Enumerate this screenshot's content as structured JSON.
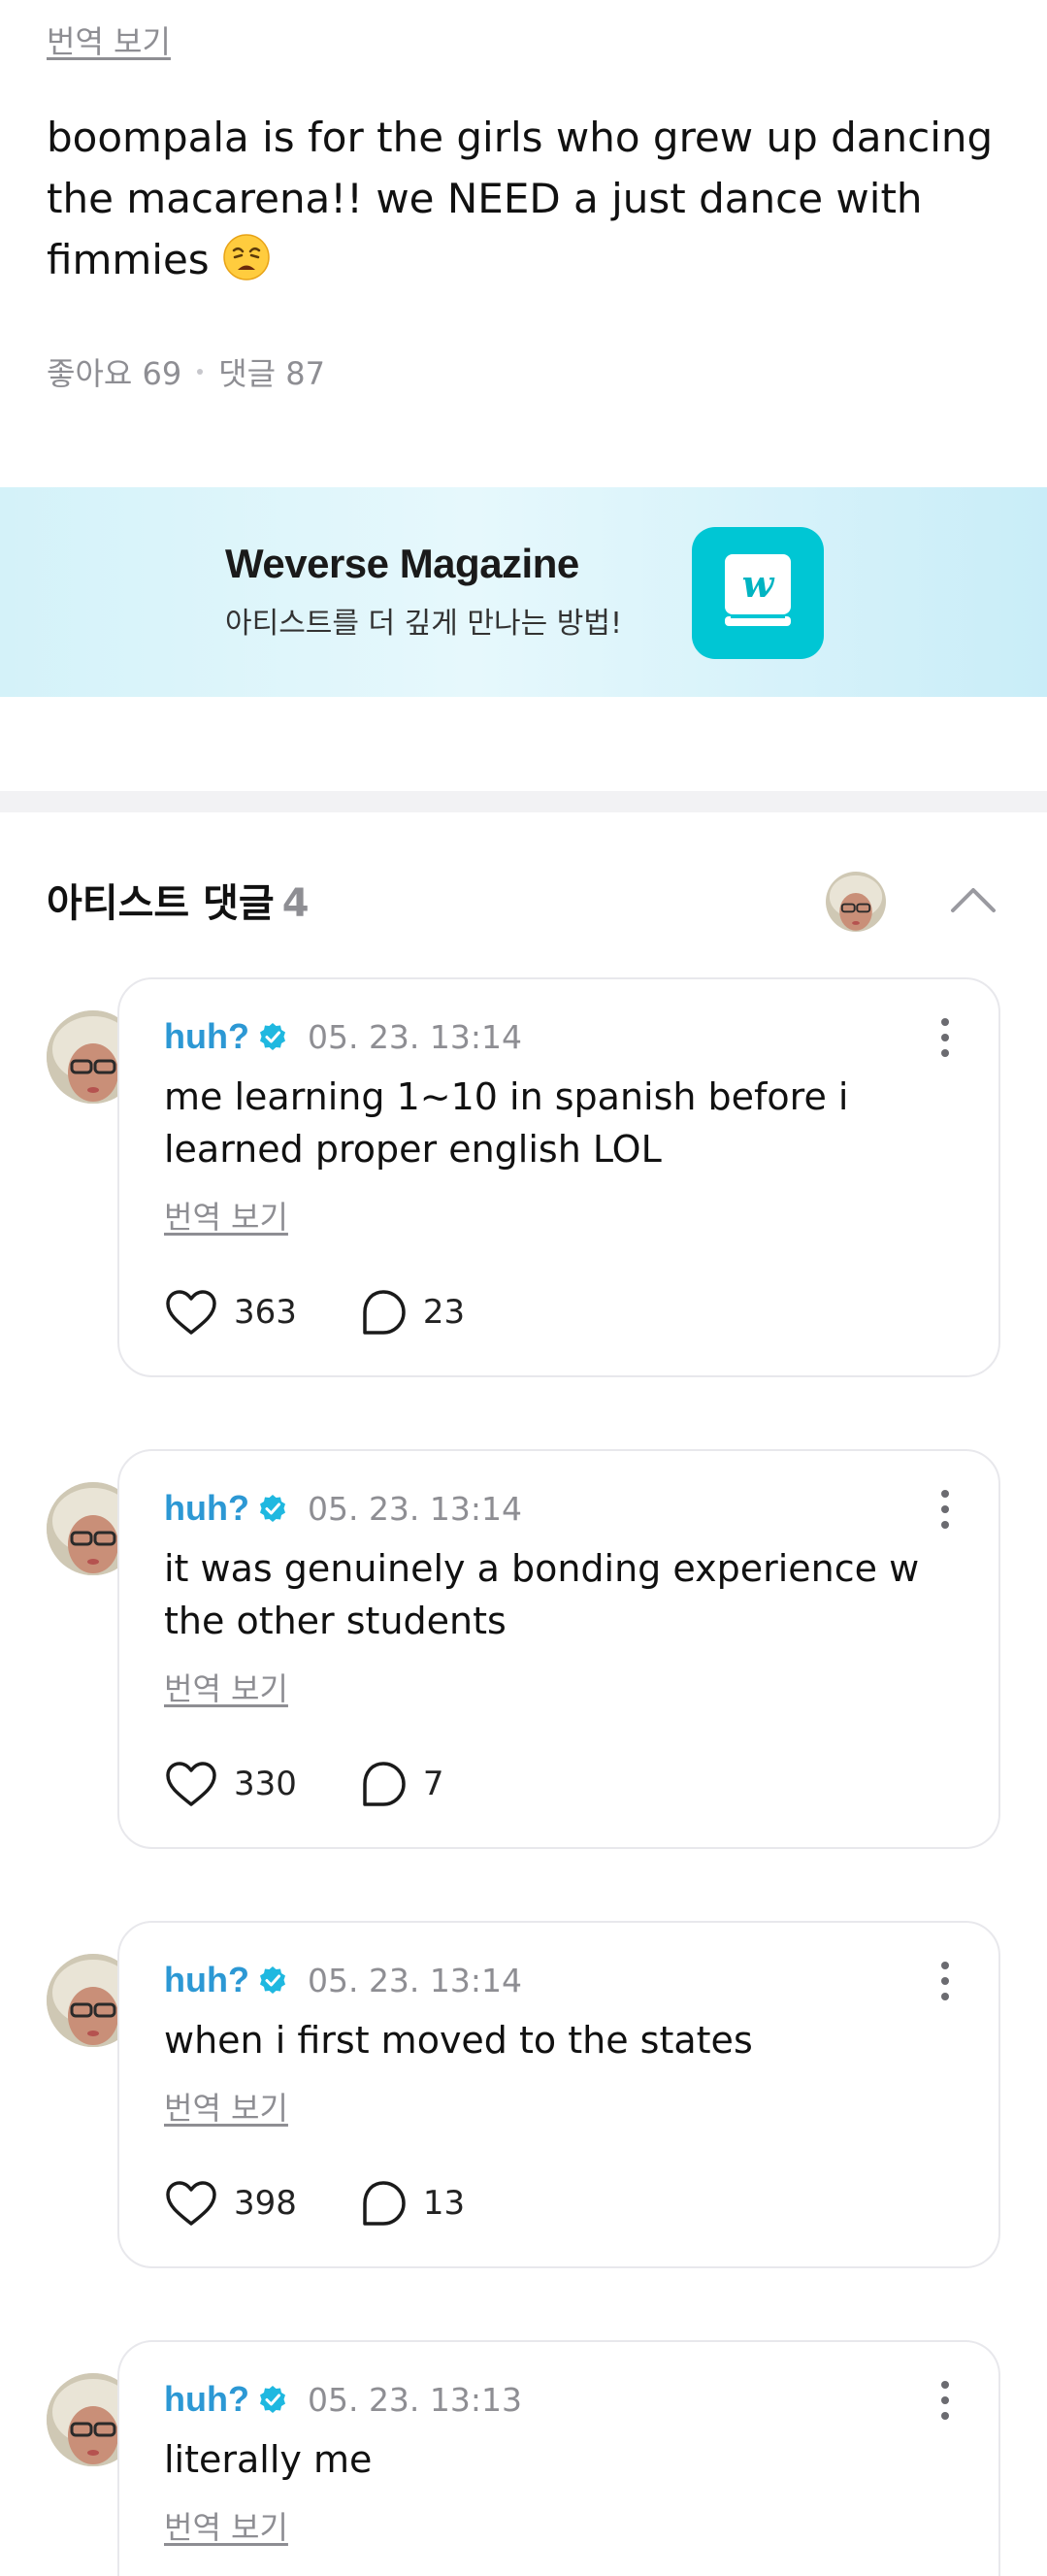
{
  "post": {
    "translate_label": "번역 보기",
    "body": "boompala is for the girls who grew up dancing the macarena!! we NEED a just dance with fimmies",
    "emoji_icon": "weary-face-emoji",
    "likes_label": "좋아요",
    "likes_count": "69",
    "comments_label": "댓글",
    "comments_count": "87"
  },
  "banner": {
    "title": "Weverse Magazine",
    "subtitle": "아티스트를 더 깊게 만나는 방법!",
    "logo_icon": "weverse-magazine-book-icon",
    "logo_color": "#00c6d4"
  },
  "artist_comments": {
    "title": "아티스트 댓글",
    "count": "4",
    "collapse_icon": "chevron-up-icon",
    "comments": [
      {
        "author": "huh?",
        "timestamp": "05. 23. 13:14",
        "text": "me learning 1~10 in spanish before i learned proper english LOL",
        "translate_label": "번역 보기",
        "likes": "363",
        "replies": "23"
      },
      {
        "author": "huh?",
        "timestamp": "05. 23. 13:14",
        "text": "it was genuinely a bonding experience w the other students",
        "translate_label": "번역 보기",
        "likes": "330",
        "replies": "7"
      },
      {
        "author": "huh?",
        "timestamp": "05. 23. 13:14",
        "text": "when i first moved to the states",
        "translate_label": "번역 보기",
        "likes": "398",
        "replies": "13"
      },
      {
        "author": "huh?",
        "timestamp": "05. 23. 13:13",
        "text": "literally me",
        "translate_label": "번역 보기"
      }
    ]
  },
  "colors": {
    "author": "#2c98d4",
    "verified_badge": "#1fb8e0",
    "muted_text": "#8e8e93",
    "card_border": "#e8e8ec"
  }
}
